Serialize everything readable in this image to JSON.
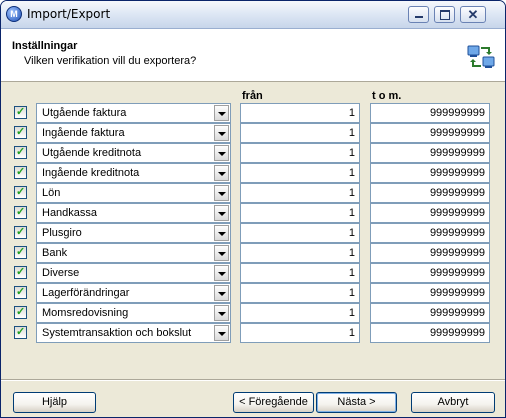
{
  "window": {
    "title": "Import/Export"
  },
  "header": {
    "title": "Inställningar",
    "subtitle": "Vilken verifikation vill du exportera?"
  },
  "columns": {
    "from": "från",
    "to": "t o m."
  },
  "rows": [
    {
      "checked": true,
      "label": "Utgående faktura",
      "from": "1",
      "to": "999999999"
    },
    {
      "checked": true,
      "label": "Ingående faktura",
      "from": "1",
      "to": "999999999"
    },
    {
      "checked": true,
      "label": "Utgående kreditnota",
      "from": "1",
      "to": "999999999"
    },
    {
      "checked": true,
      "label": "Ingående kreditnota",
      "from": "1",
      "to": "999999999"
    },
    {
      "checked": true,
      "label": "Lön",
      "from": "1",
      "to": "999999999"
    },
    {
      "checked": true,
      "label": "Handkassa",
      "from": "1",
      "to": "999999999"
    },
    {
      "checked": true,
      "label": "Plusgiro",
      "from": "1",
      "to": "999999999"
    },
    {
      "checked": true,
      "label": "Bank",
      "from": "1",
      "to": "999999999"
    },
    {
      "checked": true,
      "label": "Diverse",
      "from": "1",
      "to": "999999999"
    },
    {
      "checked": true,
      "label": "Lagerförändringar",
      "from": "1",
      "to": "999999999"
    },
    {
      "checked": true,
      "label": "Momsredovisning",
      "from": "1",
      "to": "999999999"
    },
    {
      "checked": true,
      "label": "Systemtransaktion och bokslut",
      "from": "1",
      "to": "999999999"
    }
  ],
  "buttons": {
    "help": "Hjälp",
    "previous": "< Föregående",
    "next": "Nästa >",
    "cancel": "Avbryt"
  }
}
